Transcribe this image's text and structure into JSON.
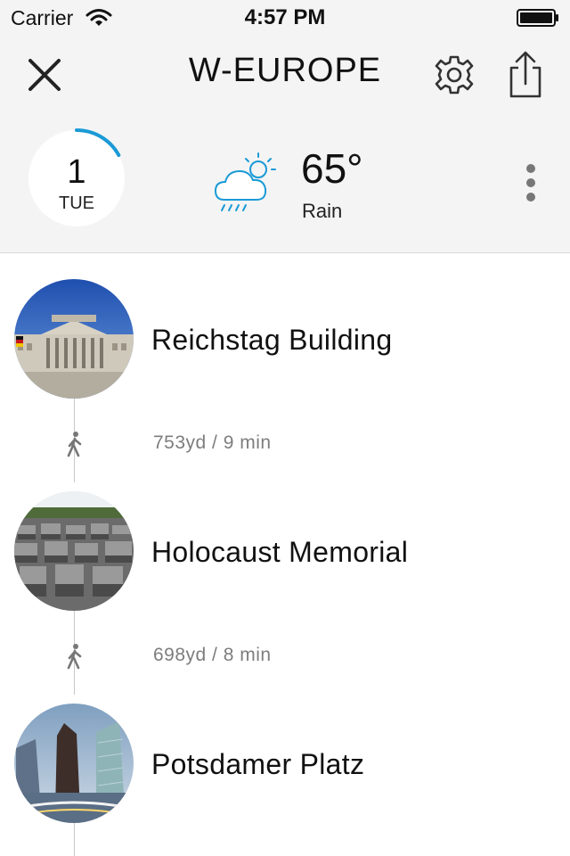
{
  "status_bar": {
    "carrier": "Carrier",
    "time": "4:57 PM"
  },
  "nav": {
    "title": "W-EUROPE"
  },
  "day": {
    "number": "1",
    "weekday": "TUE",
    "progress_fraction": 0.17
  },
  "weather": {
    "temperature": "65°",
    "condition": "Rain",
    "icon": "cloud-sun-rain-icon"
  },
  "stops": [
    {
      "name": "Reichstag Building"
    },
    {
      "name": "Holocaust Memorial"
    },
    {
      "name": "Potsdamer Platz"
    }
  ],
  "walks": [
    {
      "text": "753yd / 9 min"
    },
    {
      "text": "698yd / 8 min"
    }
  ],
  "colors": {
    "accent": "#1a9ad6",
    "bar": "#f4f4f4",
    "muted": "#7d7d7d"
  }
}
